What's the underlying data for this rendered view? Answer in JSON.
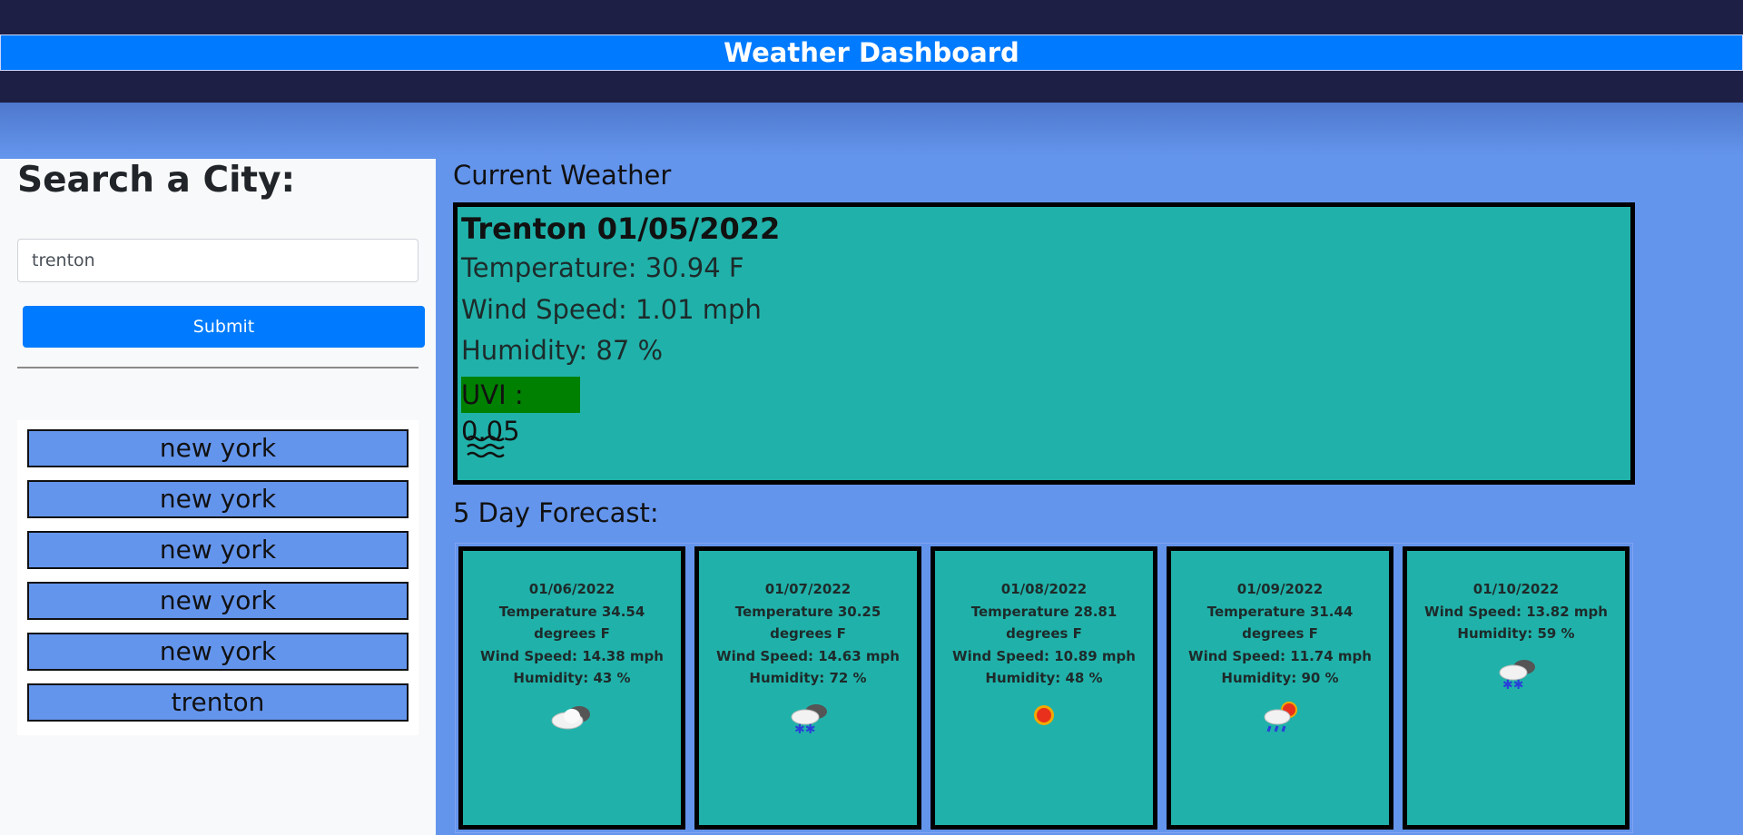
{
  "header": {
    "title": "Weather Dashboard"
  },
  "sidebar": {
    "search_title": "Search a City:",
    "search_value": "trenton",
    "submit_label": "Submit",
    "history": [
      "new york",
      "new york",
      "new york",
      "new york",
      "new york",
      "trenton"
    ]
  },
  "current": {
    "heading": "Current Weather",
    "city_date": "Trenton 01/05/2022",
    "temperature": "Temperature: 30.94 F",
    "wind": "Wind Speed: 1.01 mph",
    "humidity": "Humidity: 87 %",
    "uvi": "UVI : 0.05",
    "uvi_color": "#008000",
    "icon": "mist-icon"
  },
  "forecast": {
    "heading": "5 Day Forecast:",
    "days": [
      {
        "date": "01/06/2022",
        "temp": "Temperature 34.54",
        "unit": "degrees F",
        "wind": "Wind Speed: 14.38 mph",
        "humidity": "Humidity: 43 %",
        "icon": "cloudy-icon"
      },
      {
        "date": "01/07/2022",
        "temp": "Temperature 30.25",
        "unit": "degrees F",
        "wind": "Wind Speed: 14.63 mph",
        "humidity": "Humidity: 72 %",
        "icon": "snow-cloud-icon"
      },
      {
        "date": "01/08/2022",
        "temp": "Temperature 28.81",
        "unit": "degrees F",
        "wind": "Wind Speed: 10.89 mph",
        "humidity": "Humidity: 48 %",
        "icon": "sun-icon"
      },
      {
        "date": "01/09/2022",
        "temp": "Temperature 31.44",
        "unit": "degrees F",
        "wind": "Wind Speed: 11.74 mph",
        "humidity": "Humidity: 90 %",
        "icon": "rain-sun-icon"
      },
      {
        "date": "01/10/2022",
        "wind": "Wind Speed: 13.82 mph",
        "humidity": "Humidity: 59 %",
        "icon": "snow-cloud-icon"
      }
    ]
  },
  "colors": {
    "accent": "#007bff",
    "card": "#20b2aa",
    "background": "#6495ed",
    "header_band": "#1e1f45"
  }
}
